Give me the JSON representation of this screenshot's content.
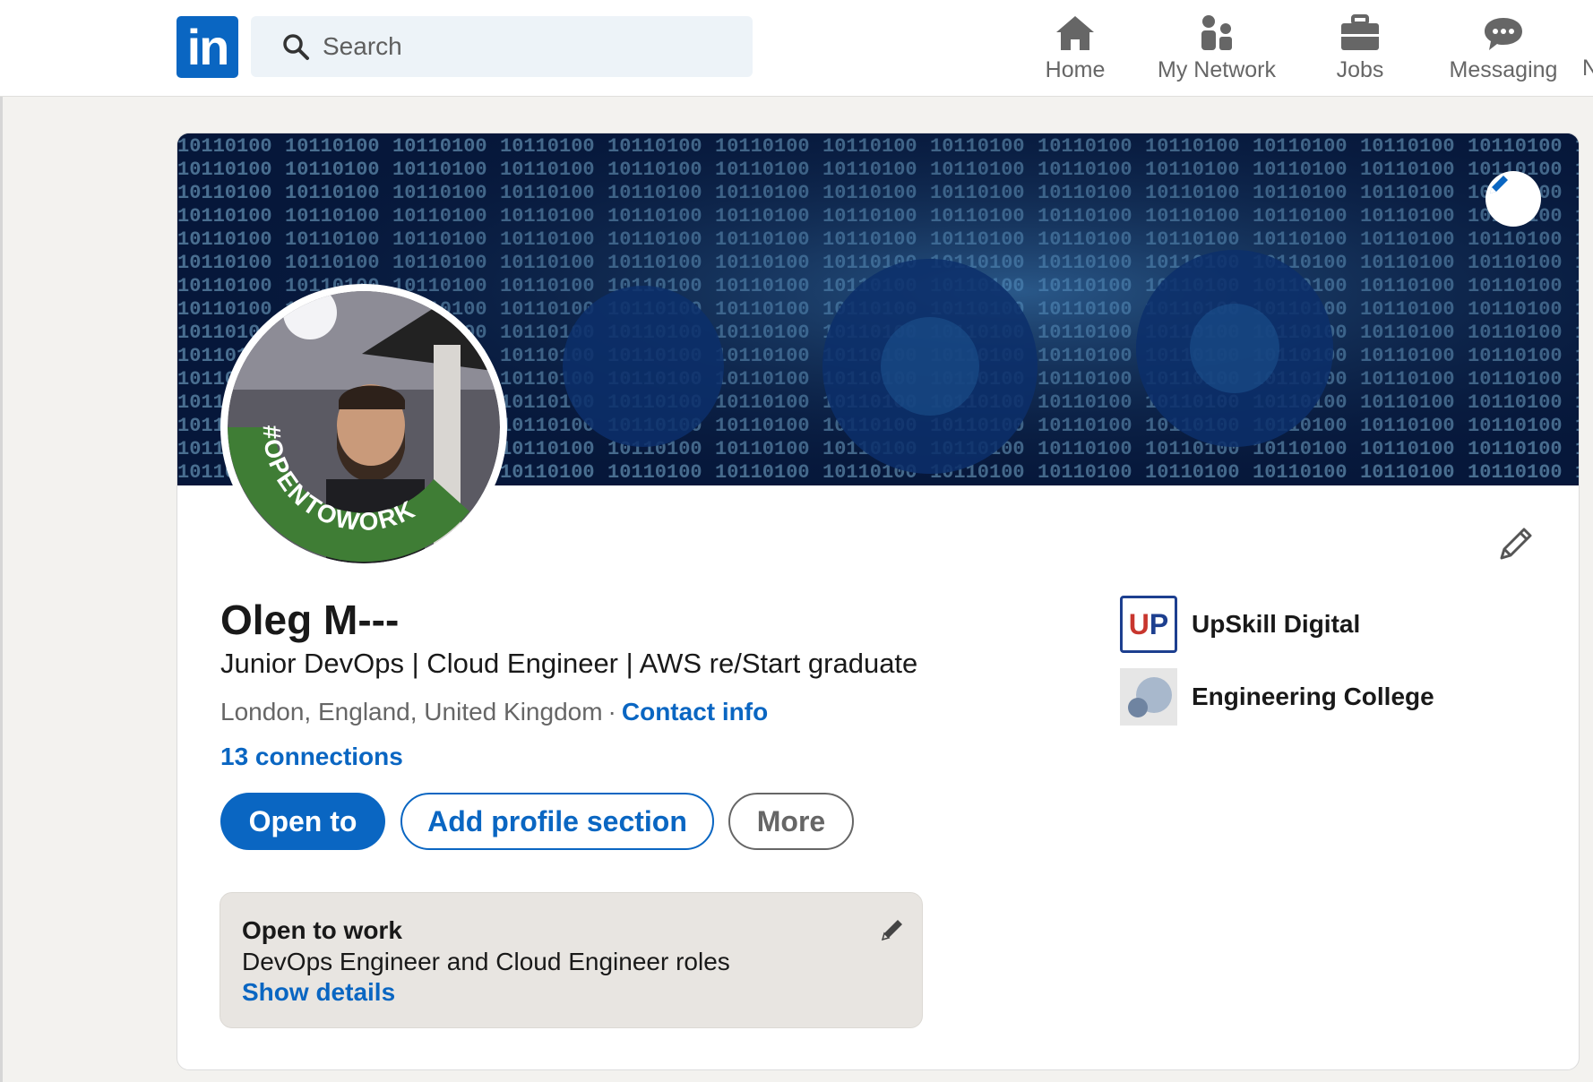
{
  "nav": {
    "logo_text": "in",
    "search_placeholder": "Search",
    "items": [
      {
        "label": "Home",
        "icon": "home-icon"
      },
      {
        "label": "My Network",
        "icon": "network-icon"
      },
      {
        "label": "Jobs",
        "icon": "briefcase-icon"
      },
      {
        "label": "Messaging",
        "icon": "messaging-icon"
      }
    ],
    "cut_label": "N"
  },
  "profile": {
    "badge_text": "#OPENTOWORK",
    "name": "Oleg M---",
    "headline": "Junior DevOps | Cloud Engineer | AWS re/Start graduate",
    "location": "London, England, United Kingdom",
    "separator": "·",
    "contact_info": "Contact info",
    "connections": "13 connections",
    "buttons": {
      "open_to": "Open to",
      "add_section": "Add profile section",
      "more": "More"
    }
  },
  "affiliations": [
    {
      "name": "UpSkill Digital",
      "logo_text_u": "U",
      "logo_text_p": "P"
    },
    {
      "name": "Engineering College"
    }
  ],
  "open_to_work": {
    "title": "Open to work",
    "description": "DevOps Engineer and Cloud Engineer roles",
    "link": "Show details"
  },
  "colors": {
    "brand": "#0a66c2",
    "open_to_work_green": "#3f7d35"
  }
}
